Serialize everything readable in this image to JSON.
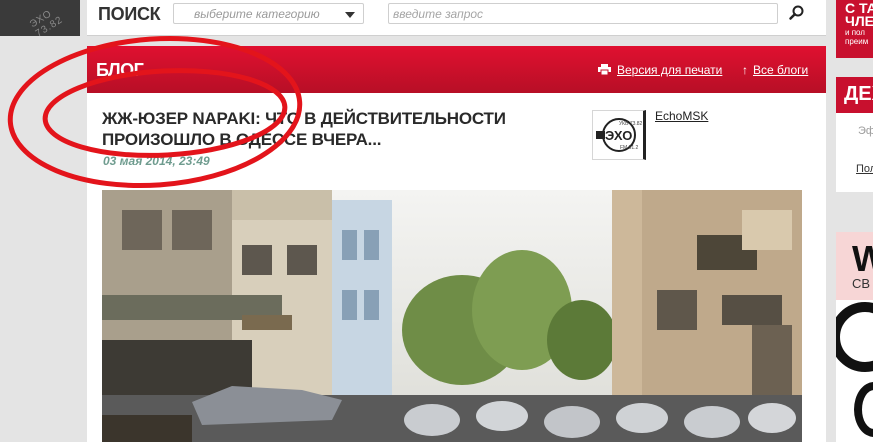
{
  "corner_logo": {
    "text": "ЭХО 73.82"
  },
  "search": {
    "title": "ПОИСК",
    "category_placeholder": "выберите категорию",
    "query_placeholder": "введите запрос",
    "search_icon": "magnifier-icon"
  },
  "blog": {
    "section_title": "БЛОГ",
    "print_link": "Версия для печати",
    "all_blogs_link": "Все блоги",
    "arrow": "↑"
  },
  "article": {
    "title": "ЖЖ-ЮЗЕР NAPAKI: ЧТО В ДЕЙСТВИТЕЛЬНОСТИ ПРОИЗОШЛО В ОДЕССЕ ВЧЕРА...",
    "date": "03 мая 2014, 23:49",
    "author": "EchoMSK",
    "photo": "street-scene-riot-police-photo"
  },
  "right_column": {
    "top_line1": "С ТА",
    "top_line2": "ЧЛЕ",
    "top_small1": "и пол",
    "top_small2": "преим",
    "panel_header": "ДЕХ",
    "panel_text": "Эф",
    "panel_link": "Пол",
    "ad_letter": "W",
    "ad_text": "СВ"
  },
  "colors": {
    "brand_red": "#c8102e",
    "date_green": "#6f9c8f",
    "annotation_red": "#e3141b"
  }
}
